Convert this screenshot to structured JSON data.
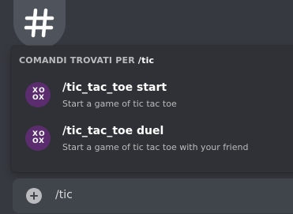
{
  "channel": {
    "icon": "hash-icon"
  },
  "autocomplete": {
    "header_prefix": "COMANDI TROVATI PER ",
    "query": "/tic",
    "commands": [
      {
        "name": "/tic_tac_toe start",
        "description": "Start a game of tic tac toe",
        "icon": "tic-tac-toe-app-icon"
      },
      {
        "name": "/tic_tac_toe duel",
        "description": "Start a game of tic tac toe with your friend",
        "icon": "tic-tac-toe-app-icon"
      }
    ]
  },
  "composer": {
    "value": "/tic",
    "attach_icon": "plus-circle-icon"
  },
  "colors": {
    "background": "#36393f",
    "popup": "#2f3136",
    "input": "#40444b",
    "app_icon": "#5b2d6e"
  }
}
